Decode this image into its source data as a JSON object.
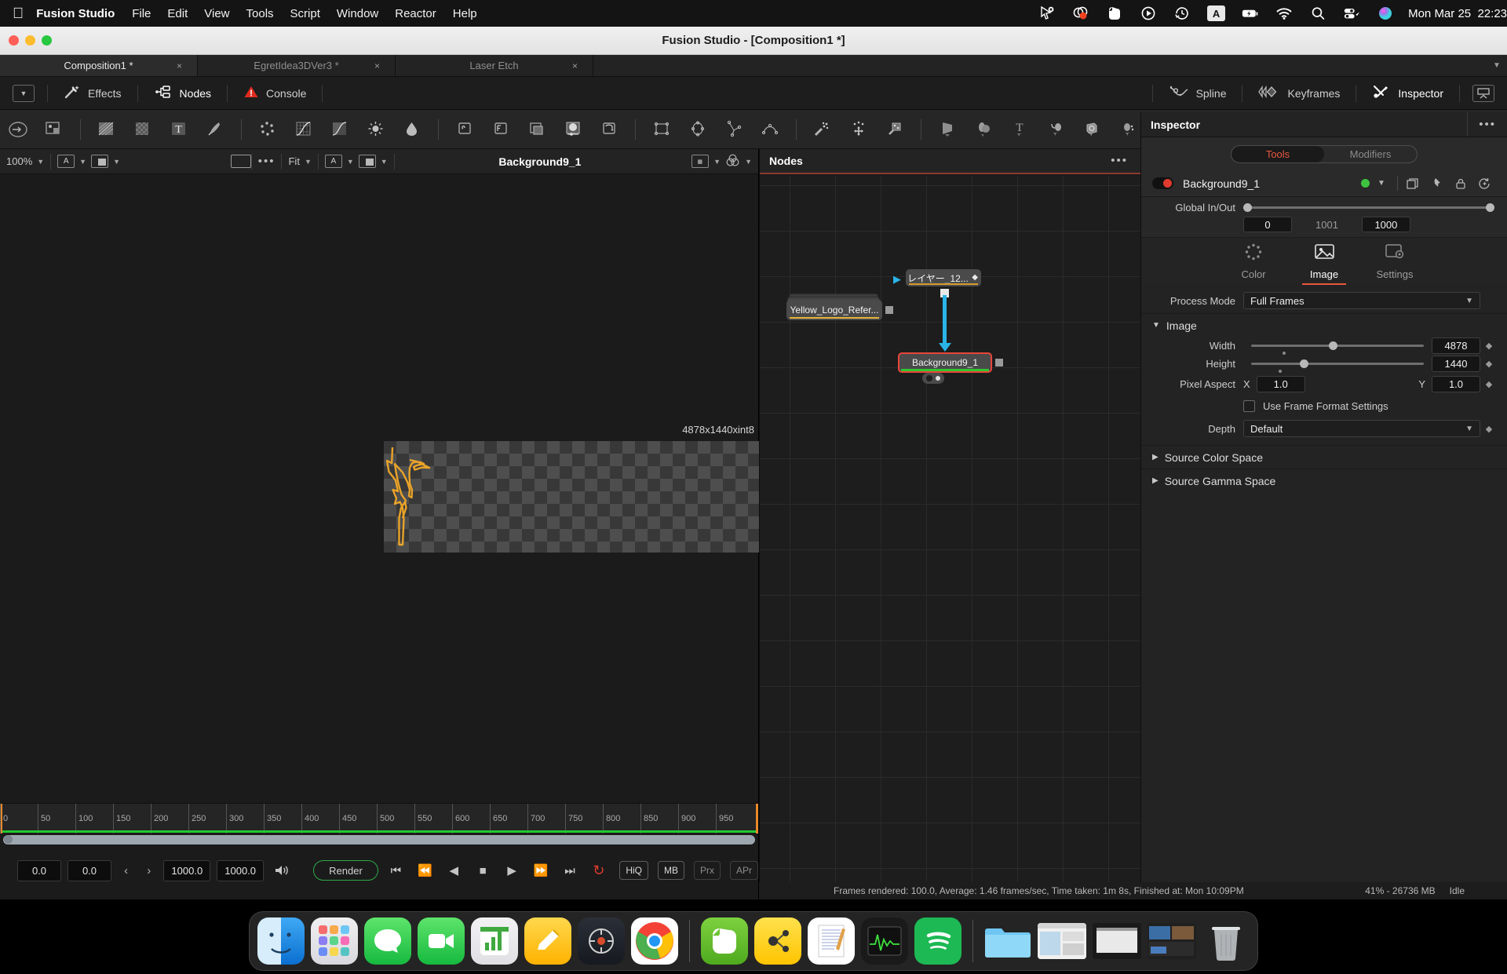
{
  "macbar": {
    "apple_icon": "apple-icon",
    "app_name": "Fusion Studio",
    "menus": [
      "File",
      "Edit",
      "View",
      "Tools",
      "Script",
      "Window",
      "Reactor",
      "Help"
    ],
    "tray_icons": [
      "cursor-badge-icon",
      "app-record-icon",
      "evernote-icon",
      "play-circle-icon",
      "time-machine-icon"
    ],
    "input_badge": "A",
    "battery_icon": "battery-charging-icon",
    "wifi_icon": "wifi-icon",
    "search_icon": "search-icon",
    "control-center_icon": "control-center-icon",
    "siri_icon": "siri-icon",
    "clock": "Mon Mar 25  22:23"
  },
  "window": {
    "title": "Fusion Studio - [Composition1 *]"
  },
  "comp_tabs": [
    {
      "label": "Composition1 *",
      "close": "×",
      "active": true
    },
    {
      "label": "EgretIdea3DVer3 *",
      "close": "×",
      "active": false
    },
    {
      "label": "Laser Etch",
      "close": "×",
      "active": false
    }
  ],
  "panelbar": {
    "left": [
      {
        "label": "Effects",
        "icon": "magic-wand-icon",
        "selected": false
      },
      {
        "label": "Nodes",
        "icon": "nodes-icon",
        "selected": true
      },
      {
        "label": "Console",
        "icon": "warning-triangle-icon",
        "selected": false
      }
    ],
    "right": [
      {
        "label": "Spline",
        "icon": "spline-icon"
      },
      {
        "label": "Keyframes",
        "icon": "keyframes-icon"
      },
      {
        "label": "Inspector",
        "icon": "inspector-icon"
      }
    ]
  },
  "viewer": {
    "zoom": "100%",
    "fit": "Fit",
    "channel_a": "A",
    "title": "Background9_1",
    "resolution_label": "4878x1440xint8"
  },
  "nodes_panel": {
    "title": "Nodes",
    "nodes": [
      {
        "name": "レイヤー_12...",
        "type": "loader",
        "accent": "#d79a2b"
      },
      {
        "name": "Yellow_Logo_Refer...",
        "type": "clip",
        "accent": "#e5b53c"
      },
      {
        "name": "Background9_1",
        "type": "background",
        "accent": "#3fc43f",
        "selected": true
      }
    ]
  },
  "inspector": {
    "title": "Inspector",
    "segments": [
      {
        "label": "Tools",
        "active": true
      },
      {
        "label": "Modifiers",
        "active": false
      }
    ],
    "tool_name": "Background9_1",
    "tool_icons": [
      "duplicate-icon",
      "pin-icon",
      "lock-icon",
      "reset-icon"
    ],
    "global_in_out": {
      "label": "Global In/Out",
      "in_value": "0",
      "middle_value": "1001",
      "out_value": "1000"
    },
    "tabs": [
      {
        "label": "Color",
        "icon": "color-wheel-icon",
        "active": false
      },
      {
        "label": "Image",
        "icon": "image-icon",
        "active": true
      },
      {
        "label": "Settings",
        "icon": "settings-icon",
        "active": false
      }
    ],
    "process_mode": {
      "label": "Process Mode",
      "value": "Full Frames"
    },
    "image_section": {
      "label": "Image",
      "width": {
        "label": "Width",
        "value": "4878"
      },
      "height": {
        "label": "Height",
        "value": "1440"
      },
      "pixel_aspect": {
        "label": "Pixel Aspect",
        "x_label": "X",
        "x_value": "1.0",
        "y_label": "Y",
        "y_value": "1.0"
      },
      "use_frame_format": "Use Frame Format Settings",
      "depth": {
        "label": "Depth",
        "value": "Default"
      }
    },
    "collapsed_sections": [
      "Source Color Space",
      "Source Gamma Space"
    ]
  },
  "timeline": {
    "ticks": [
      "0",
      "50",
      "100",
      "150",
      "200",
      "250",
      "300",
      "350",
      "400",
      "450",
      "500",
      "550",
      "600",
      "650",
      "700",
      "750",
      "800",
      "850",
      "900",
      "950"
    ],
    "render_start": "0.0",
    "render_end": "0.0",
    "comp_start": "1000.0",
    "comp_end": "1000.0",
    "render_button": "Render",
    "quality": [
      "HiQ",
      "MB",
      "Prx",
      "APr"
    ]
  },
  "statusbar": {
    "message": "Frames rendered: 100.0,  Average: 1.46 frames/sec,  Time taken: 1m 8s,  Finished at: Mon 10:09PM",
    "memory": "41% - 26736 MB",
    "state": "Idle"
  },
  "dock": {
    "apps": [
      "finder-icon",
      "launchpad-icon",
      "messages-icon",
      "facetime-icon",
      "numbers-icon",
      "notes-icon",
      "davinci-resolve-icon",
      "chrome-icon",
      "evernote-icon",
      "mindnode-icon",
      "pages-icon",
      "activity-monitor-icon",
      "spotify-icon"
    ],
    "files": [
      "folder-icon",
      "window-thumb-1",
      "window-thumb-2",
      "window-thumb-3",
      "trash-icon"
    ]
  }
}
